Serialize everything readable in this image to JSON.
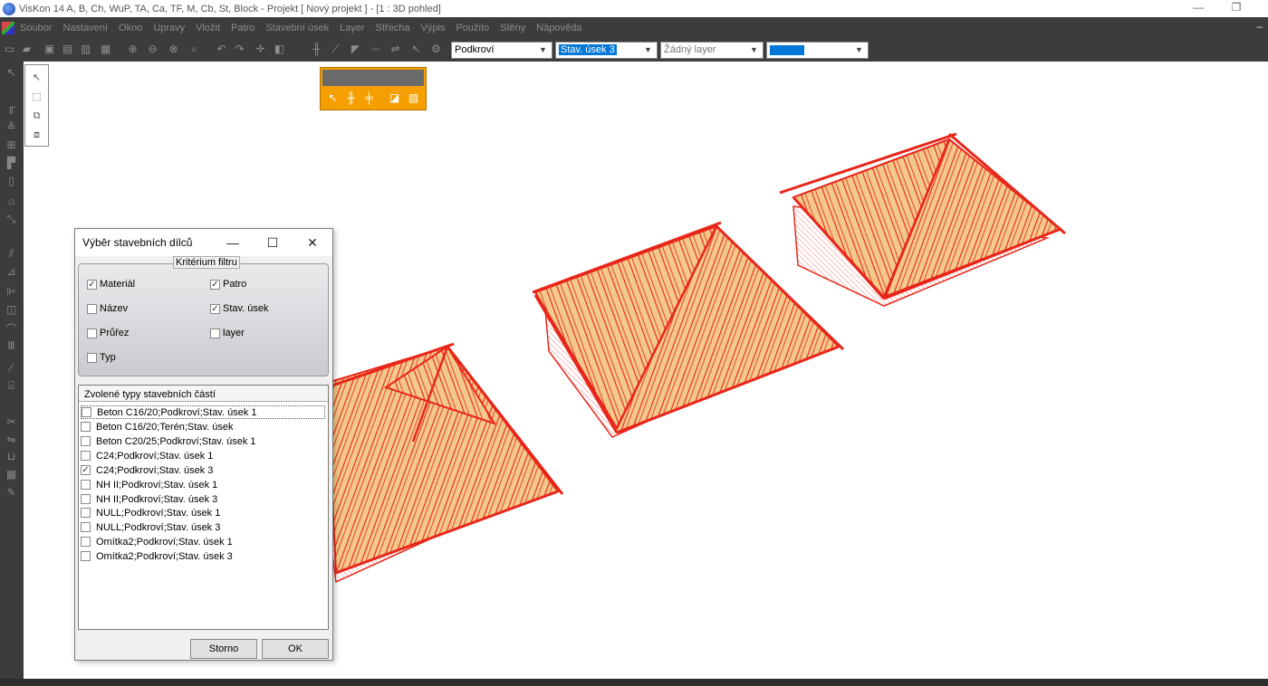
{
  "window": {
    "title": "VisKon 14 A, B, Ch, WuP, TA, Ca, TF, M, Cb, St, Block - Projekt [ Nový projekt ]  - [1 : 3D pohled]",
    "minimize": "—",
    "restore": "❐"
  },
  "menu": {
    "items": [
      "Soubor",
      "Nastavení",
      "Okno",
      "Úpravy",
      "Vložit",
      "Patro",
      "Stavební úsek",
      "Layer",
      "Střecha",
      "Výpis",
      "Použito",
      "Stěny",
      "Nápověda"
    ],
    "right_glyph": "–"
  },
  "toolbar": {
    "floor_combo": "Podkroví",
    "section_combo": "Stav. úsek 3",
    "layer_combo": "Žádný layer",
    "color_combo": ""
  },
  "dialog": {
    "title": "Výběr stavebních dílců",
    "minimize": "—",
    "maximize": "☐",
    "close": "✕",
    "filter_legend": "Kritérium filtru",
    "filters": [
      {
        "label": "Materiál",
        "checked": true
      },
      {
        "label": "Patro",
        "checked": true
      },
      {
        "label": "Název",
        "checked": false
      },
      {
        "label": "Stav. úsek",
        "checked": true
      },
      {
        "label": "Průřez",
        "checked": false
      },
      {
        "label": "layer",
        "checked": false
      },
      {
        "label": "Typ",
        "checked": false
      }
    ],
    "list_header": "Zvolené typy stavebních částí",
    "list_items": [
      {
        "label": "Beton C16/20;Podkroví;Stav. úsek 1",
        "checked": false
      },
      {
        "label": "Beton C16/20;Terén;Stav. úsek",
        "checked": false
      },
      {
        "label": "Beton C20/25;Podkroví;Stav. úsek 1",
        "checked": false
      },
      {
        "label": "C24;Podkroví;Stav. úsek 1",
        "checked": false
      },
      {
        "label": "C24;Podkroví;Stav. úsek 3",
        "checked": true
      },
      {
        "label": "NH II;Podkroví;Stav. úsek 1",
        "checked": false
      },
      {
        "label": "NH II;Podkroví;Stav. úsek 3",
        "checked": false
      },
      {
        "label": "NULL;Podkroví;Stav. úsek 1",
        "checked": false
      },
      {
        "label": "NULL;Podkroví;Stav. úsek 3",
        "checked": false
      },
      {
        "label": "Omítka2;Podkroví;Stav. úsek 1",
        "checked": false
      },
      {
        "label": "Omítka2;Podkroví;Stav. úsek 3",
        "checked": false
      }
    ],
    "cancel_label": "Storno",
    "ok_label": "OK"
  },
  "colors": {
    "rafter_red": "#e8261a",
    "roof_wood": "#f2c98a",
    "chrome_dark": "#3c3c3c",
    "floating_toolbar": "#f5a000"
  }
}
